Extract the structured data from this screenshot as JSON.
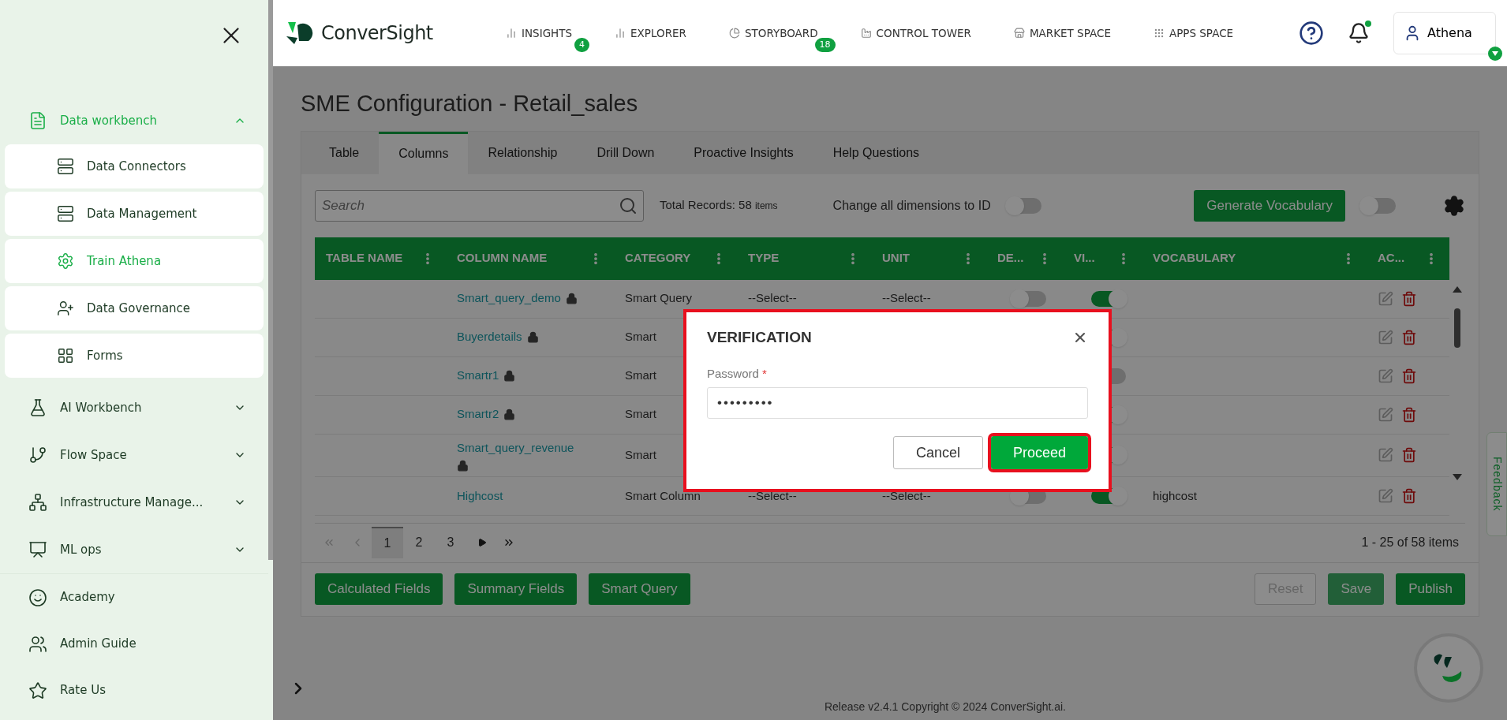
{
  "sidebar": {
    "items": [
      {
        "label": "Data workbench",
        "expanded": true,
        "active": true,
        "children": [
          {
            "label": "Data Connectors",
            "selected": false
          },
          {
            "label": "Data Management",
            "selected": false
          },
          {
            "label": "Train Athena",
            "selected": true
          },
          {
            "label": "Data Governance",
            "selected": false
          },
          {
            "label": "Forms",
            "selected": false
          }
        ]
      },
      {
        "label": "AI Workbench",
        "expanded": false,
        "active": false
      },
      {
        "label": "Flow Space",
        "expanded": false,
        "active": false
      },
      {
        "label": "Infrastructure Manage...",
        "expanded": false,
        "active": false
      },
      {
        "label": "ML ops",
        "expanded": false,
        "active": false
      }
    ],
    "footer_items": [
      {
        "label": "Academy"
      },
      {
        "label": "Admin Guide"
      },
      {
        "label": "Rate Us"
      }
    ]
  },
  "header": {
    "logo": "ConverSight",
    "nav": [
      {
        "label": "INSIGHTS",
        "badge": "4"
      },
      {
        "label": "EXPLORER"
      },
      {
        "label": "STORYBOARD",
        "badge": "18"
      },
      {
        "label": "CONTROL TOWER"
      },
      {
        "label": "MARKET SPACE"
      },
      {
        "label": "APPS SPACE"
      }
    ],
    "notifications": {
      "unread": true
    },
    "user": {
      "name": "Athena"
    }
  },
  "page_title": "SME Configuration - Retail_sales",
  "tabs": [
    {
      "label": "Table",
      "selected": false
    },
    {
      "label": "Columns",
      "selected": true
    },
    {
      "label": "Relationship",
      "selected": false
    },
    {
      "label": "Drill Down",
      "selected": false
    },
    {
      "label": "Proactive Insights",
      "selected": false
    },
    {
      "label": "Help Questions",
      "selected": false
    }
  ],
  "toolbar": {
    "search": {
      "placeholder": "Search"
    },
    "total_label": "Total Records: 58",
    "total_unit": "items",
    "dimension_toggle": {
      "label": "Change all dimensions to ID",
      "on": false
    },
    "generate_button": "Generate Vocabulary",
    "vocabulary_toggle": {
      "on": false
    }
  },
  "table": {
    "columns": [
      "TABLE NAME",
      "COLUMN NAME",
      "CATEGORY",
      "TYPE",
      "UNIT",
      "DE...",
      "VI...",
      "VOCABULARY",
      "AC..."
    ],
    "rows": [
      {
        "column_name": "Smart_query_demo",
        "locked": true,
        "category": "Smart Query",
        "type": "--Select--",
        "unit": "--Select--",
        "de": false,
        "vi": true
      },
      {
        "column_name": "Buyerdetails",
        "locked": true,
        "category": "Smart",
        "vi": true
      },
      {
        "column_name": "Smartr1",
        "locked": true,
        "category": "Smart",
        "vi": false
      },
      {
        "column_name": "Smartr2",
        "locked": true,
        "category": "Smart",
        "vi": true
      },
      {
        "column_name": "Smart_query_revenue",
        "locked": true,
        "category": "Smart",
        "vi": true
      },
      {
        "column_name": "Highcost",
        "locked": false,
        "category": "Smart Column",
        "type": "--Select--",
        "unit": "--Select--",
        "de": false,
        "vi": true,
        "vocabulary": "highcost"
      }
    ]
  },
  "pagination": {
    "pages": [
      {
        "label": "1",
        "selected": true
      },
      {
        "label": "2",
        "selected": false
      },
      {
        "label": "3",
        "selected": false
      }
    ],
    "summary": "1 - 25 of 58 items"
  },
  "actions_left": [
    "Calculated Fields",
    "Summary Fields",
    "Smart Query"
  ],
  "actions_right": [
    {
      "label": "Reset",
      "kind": "outline",
      "disabled": true
    },
    {
      "label": "Save",
      "kind": "solid",
      "disabled": true
    },
    {
      "label": "Publish",
      "kind": "solid",
      "disabled": false
    }
  ],
  "dialog": {
    "title": "VERIFICATION",
    "field_label": "Password",
    "required_mark": "*",
    "value": "•••••••••",
    "buttons": [
      {
        "label": "Cancel",
        "kind": "secondary",
        "highlighted": false
      },
      {
        "label": "Proceed",
        "kind": "primary",
        "highlighted": true
      }
    ]
  },
  "footer": "Release v2.4.1 Copyright © 2024 ConverSight.ai.",
  "feedback": "Feedback"
}
